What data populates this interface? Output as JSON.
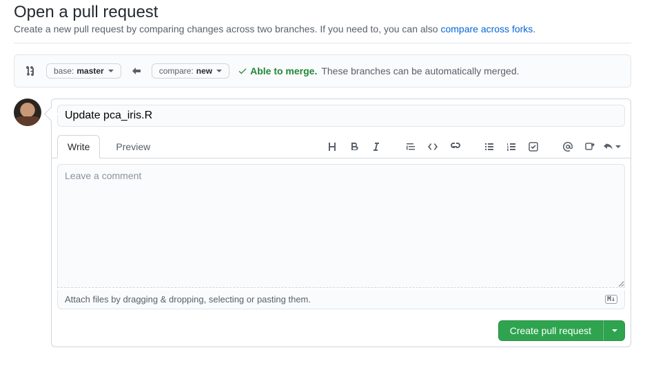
{
  "header": {
    "title": "Open a pull request",
    "subtitle_before": "Create a new pull request by comparing changes across two branches. If you need to, you can also ",
    "subtitle_link": "compare across forks",
    "subtitle_after": "."
  },
  "range": {
    "base_label": "base: ",
    "base_value": "master",
    "compare_label": "compare: ",
    "compare_value": "new"
  },
  "merge": {
    "status_label": "Able to merge.",
    "status_message": "These branches can be automatically merged."
  },
  "compose": {
    "title_value": "Update pca_iris.R",
    "tabs": {
      "write": "Write",
      "preview": "Preview"
    },
    "body_value": "",
    "body_placeholder": "Leave a comment",
    "attach_hint": "Attach files by dragging & dropping, selecting or pasting them.",
    "md_badge": "M↓"
  },
  "actions": {
    "submit_label": "Create pull request"
  }
}
